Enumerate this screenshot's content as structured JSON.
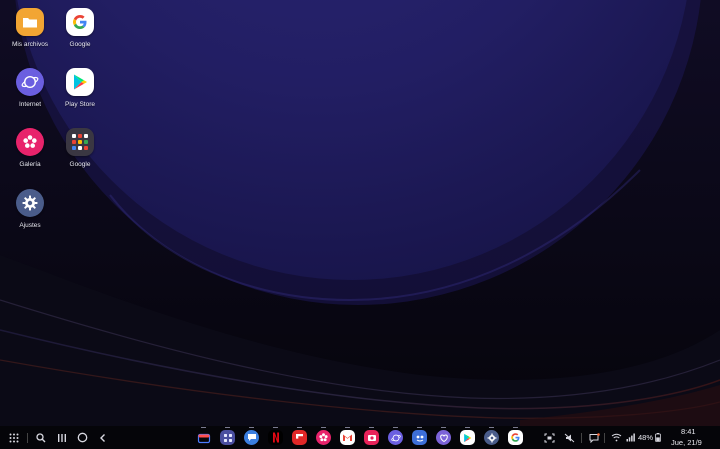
{
  "home": {
    "apps": [
      {
        "label": "Mis archivos",
        "icon": "folder-icon"
      },
      {
        "label": "Google",
        "icon": "google-icon"
      },
      {
        "label": "Internet",
        "icon": "internet-icon"
      },
      {
        "label": "Play Store",
        "icon": "play-store-icon"
      },
      {
        "label": "Galería",
        "icon": "gallery-icon"
      },
      {
        "label": "Google",
        "icon": "google-folder-icon"
      },
      {
        "label": "Ajustes",
        "icon": "settings-icon"
      }
    ]
  },
  "taskbar": {
    "nav": [
      "apps-grid-icon",
      "search-icon",
      "recents-icon",
      "home-icon",
      "back-icon"
    ],
    "dock": [
      "tv-icon",
      "apps-edge-icon",
      "messages-icon",
      "netflix-icon",
      "flipboard-icon",
      "gallery-icon",
      "gmail-icon",
      "camera-icon",
      "internet-icon",
      "tips-icon",
      "themes-icon",
      "play-store-icon",
      "settings-icon",
      "google-icon"
    ],
    "status": {
      "battery": "48%",
      "time": "8:41",
      "date": "Jue, 21/9"
    }
  },
  "colors": {
    "wallpaper_circle": "#23206a",
    "wallpaper_dark": "#0a0814",
    "taskbar": "#050509"
  }
}
